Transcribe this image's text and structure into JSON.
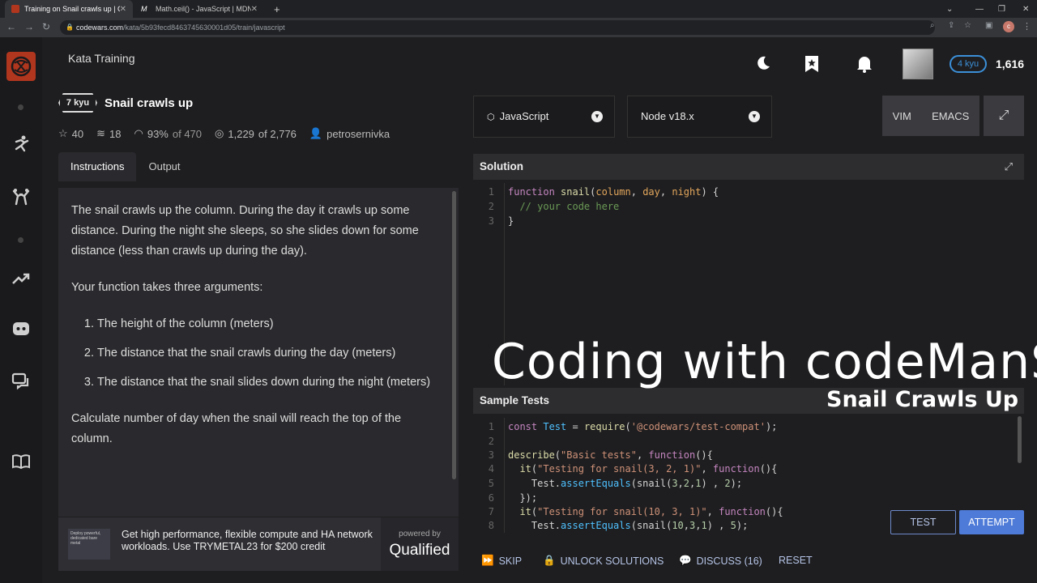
{
  "browser": {
    "tabs": [
      {
        "title": "Training on Snail crawls up | Cod",
        "favicon_color": "#b1361e"
      },
      {
        "title": "Math.ceil() - JavaScript | MDN",
        "favicon_color": "#ffffff"
      }
    ],
    "url_domain": "codewars.com",
    "url_path": "/kata/5b93fecd8463745630001d05/train/javascript"
  },
  "header": {
    "title": "Kata Training",
    "user_rank": "4 kyu",
    "honor": "1,616"
  },
  "kata": {
    "kyu": "7 kyu",
    "title": "Snail crawls up",
    "stars": "40",
    "collections": "18",
    "satisfaction": "93%",
    "satisfaction_of": "of 470",
    "completed": "1,229",
    "completed_of": "of 2,776",
    "author": "petrosernivka"
  },
  "tabs": {
    "instructions": "Instructions",
    "output": "Output"
  },
  "instructions": {
    "p1": "The snail crawls up the column. During the day it crawls up some distance. During the night she sleeps, so she slides down for some distance (less than crawls up during the day).",
    "p2": "Your function takes three arguments:",
    "items": [
      "The height of the column (meters)",
      "The distance that the snail crawls during the day (meters)",
      "The distance that the snail slides down during the night (meters)"
    ],
    "p3": "Calculate number of day when the snail will reach the top of the column."
  },
  "ad": {
    "image_text": "Deploy powerful, dedicated bare metal",
    "text": "Get high performance, flexible compute and HA network workloads. Use TRYMETAL23 for $200 credit",
    "powered_by": "powered by",
    "brand": "Qualified"
  },
  "editor_toolbar": {
    "language": "JavaScript",
    "runtime": "Node v18.x",
    "vim": "VIM",
    "emacs": "EMACS"
  },
  "solution": {
    "label": "Solution",
    "line_numbers": [
      "1",
      "2",
      "3"
    ]
  },
  "sample_tests": {
    "label": "Sample Tests",
    "line_numbers": [
      "1",
      "2",
      "3",
      "4",
      "5",
      "6",
      "7",
      "8"
    ]
  },
  "overlay": {
    "title": "Coding with codeManS",
    "subtitle": "Snail Crawls Up"
  },
  "bottom_bar": {
    "skip": "SKIP",
    "unlock": "UNLOCK SOLUTIONS",
    "discuss": "DISCUSS (16)",
    "reset": "RESET",
    "test": "TEST",
    "attempt": "ATTEMPT"
  },
  "colors": {
    "accent_blue": "#4e7bd8",
    "brand_red": "#b1361e",
    "rank_blue": "#3b8fd8"
  }
}
